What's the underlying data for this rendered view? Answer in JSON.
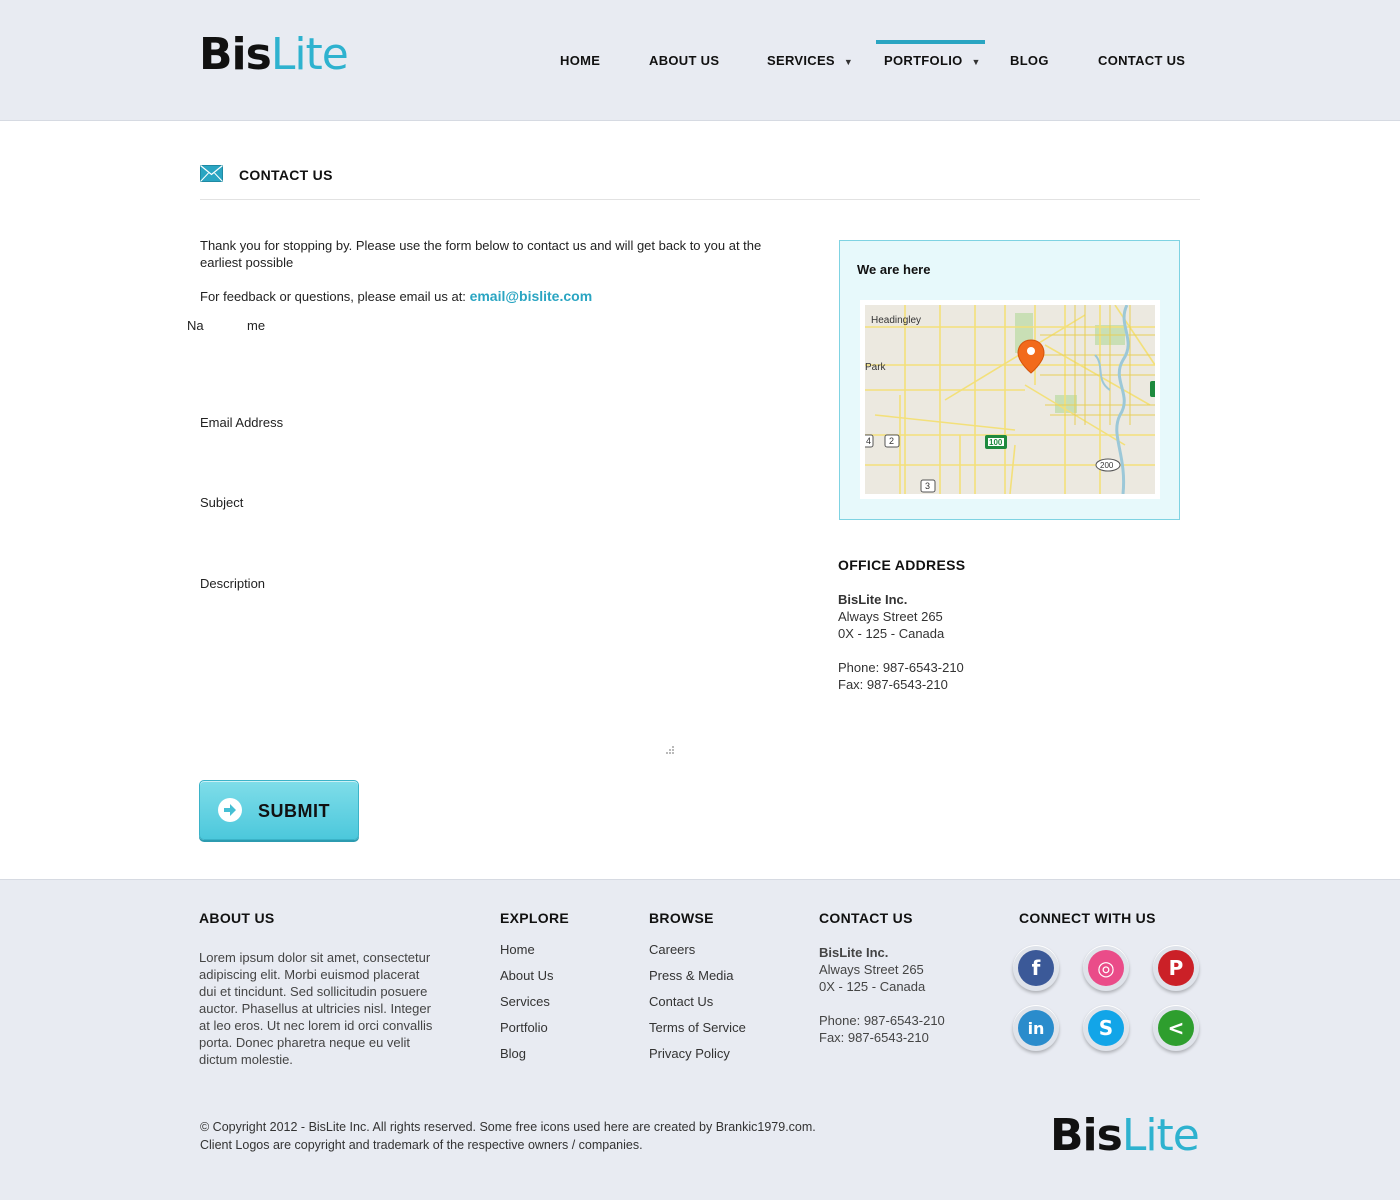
{
  "brand": {
    "bis": "Bis",
    "lite": "Lite"
  },
  "nav": {
    "items": [
      {
        "label": "HOME"
      },
      {
        "label": "ABOUT US"
      },
      {
        "label": "SERVICES"
      },
      {
        "label": "PORTFOLIO"
      },
      {
        "label": "BLOG"
      },
      {
        "label": "CONTACT US"
      }
    ],
    "active": "PORTFOLIO"
  },
  "page": {
    "title": "CONTACT US",
    "intro": "Thank you for stopping by. Please use the form below to contact us and will get back to you at the earliest possible",
    "feedback_text": "For feedback or questions, please email us at:",
    "email": "email@bislite.com"
  },
  "form": {
    "name_label_a": "Na",
    "name_label_b": "me",
    "email_label": "Email Address",
    "subject_label": "Subject",
    "description_label": "Description",
    "submit_label": "SUBMIT"
  },
  "map": {
    "title": "We are here",
    "labels": {
      "headingley": "Headingley",
      "park": "Park",
      "r4": "4",
      "r2": "2",
      "r3": "3",
      "r100": "100",
      "r200": "200"
    }
  },
  "office": {
    "title": "OFFICE ADDRESS",
    "company": "BisLite Inc.",
    "street": "Always Street 265",
    "city": "0X - 125 - Canada",
    "phone": "Phone: 987-6543-210",
    "fax": "Fax: 987-6543-210"
  },
  "footer": {
    "about_title": "ABOUT US",
    "about_text": "Lorem ipsum dolor sit amet, consectetur adipiscing elit. Morbi euismod placerat dui et tincidunt. Sed sollicitudin posuere auctor. Phasellus at ultricies nisl. Integer at leo eros. Ut nec lorem id orci convallis porta. Donec pharetra neque eu velit dictum molestie.",
    "explore_title": "EXPLORE",
    "explore": [
      "Home",
      "About Us",
      "Services",
      "Portfolio",
      "Blog"
    ],
    "browse_title": "BROWSE",
    "browse": [
      "Careers",
      "Press & Media",
      "Contact Us",
      "Terms of Service",
      "Privacy Policy"
    ],
    "contact_title": "CONTACT US",
    "contact_company": "BisLite Inc.",
    "contact_street": "Always Street 265",
    "contact_city": "0X - 125 - Canada",
    "contact_phone": "Phone: 987-6543-210",
    "contact_fax": "Fax: 987-6543-210",
    "connect_title": "CONNECT WITH US",
    "social": [
      {
        "name": "facebook-icon",
        "glyph": "f",
        "color": "#3b5998"
      },
      {
        "name": "dribbble-icon",
        "glyph": "◎",
        "color": "#ea4c89"
      },
      {
        "name": "pinterest-icon",
        "glyph": "P",
        "color": "#cb2027"
      },
      {
        "name": "linkedin-icon",
        "glyph": "in",
        "color": "#2a8ccc"
      },
      {
        "name": "skype-icon",
        "glyph": "S",
        "color": "#12a5e8"
      },
      {
        "name": "share-icon",
        "glyph": "<",
        "color": "#2e9e2e"
      }
    ],
    "copyright_line1": "© Copyright 2012 - BisLite Inc. All rights reserved. Some free icons used here are created by Brankic1979.com.",
    "copyright_line2": "Client Logos are copyright and trademark of the respective owners / companies."
  },
  "colors": {
    "accent": "#2aa5c2",
    "header_bg": "#e8ebf2",
    "map_box_bg": "#e7f9fb"
  }
}
